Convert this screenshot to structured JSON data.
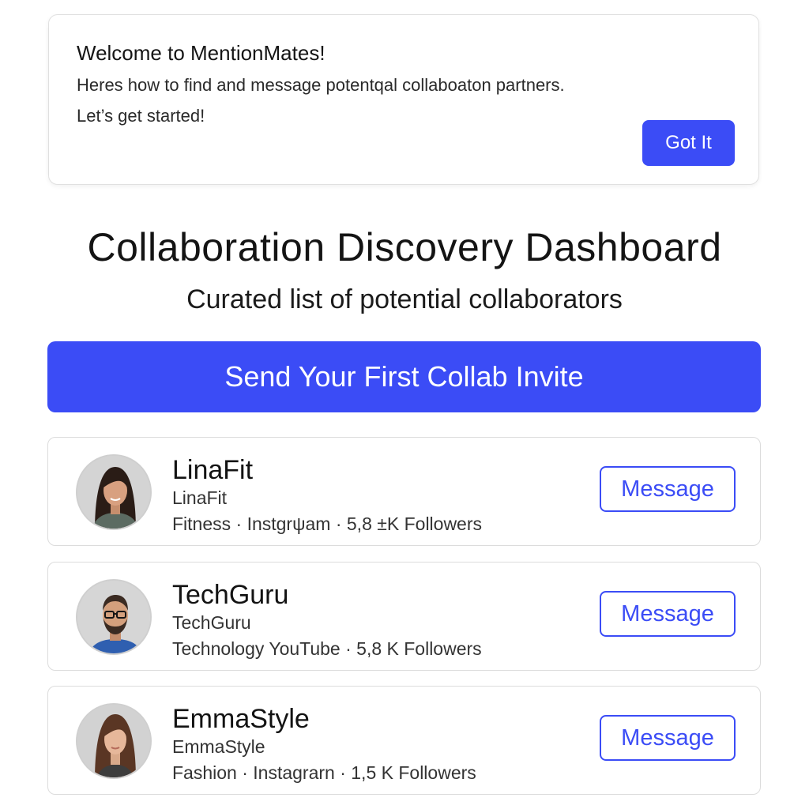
{
  "colors": {
    "accent": "#3b4cf6",
    "card_border": "#dcdcdc",
    "text": "#161616"
  },
  "welcome": {
    "title": "Welcome to MentionMates!",
    "line1": "Heres how to find and message potentqal collaboaton partners.",
    "line2": "Let’s get started!",
    "got_it_label": "Got It"
  },
  "header": {
    "title": "Collaboration Discovery Dashboard",
    "subtitle": "Curated list of potential collaborators"
  },
  "cta": {
    "label": "Send Your First Collab Invite"
  },
  "creators": [
    {
      "name": "LinaFit",
      "handle": "LinaFit",
      "meta": "Fitness · Instgrψam · 5,8 ±K Followers",
      "message_label": "Message",
      "avatar_icon": "woman-dark-hair-avatar"
    },
    {
      "name": "TechGuru",
      "handle": "TechGuru",
      "meta": "Technology   YouTube · 5,8 K Followers",
      "message_label": "Message",
      "avatar_icon": "man-glasses-beard-avatar"
    },
    {
      "name": "EmmaStyle",
      "handle": "EmmaStyle",
      "meta": "Fashion · Instagrarn · 1,5 K Followers",
      "message_label": "Message",
      "avatar_icon": "woman-brown-hair-avatar"
    }
  ]
}
